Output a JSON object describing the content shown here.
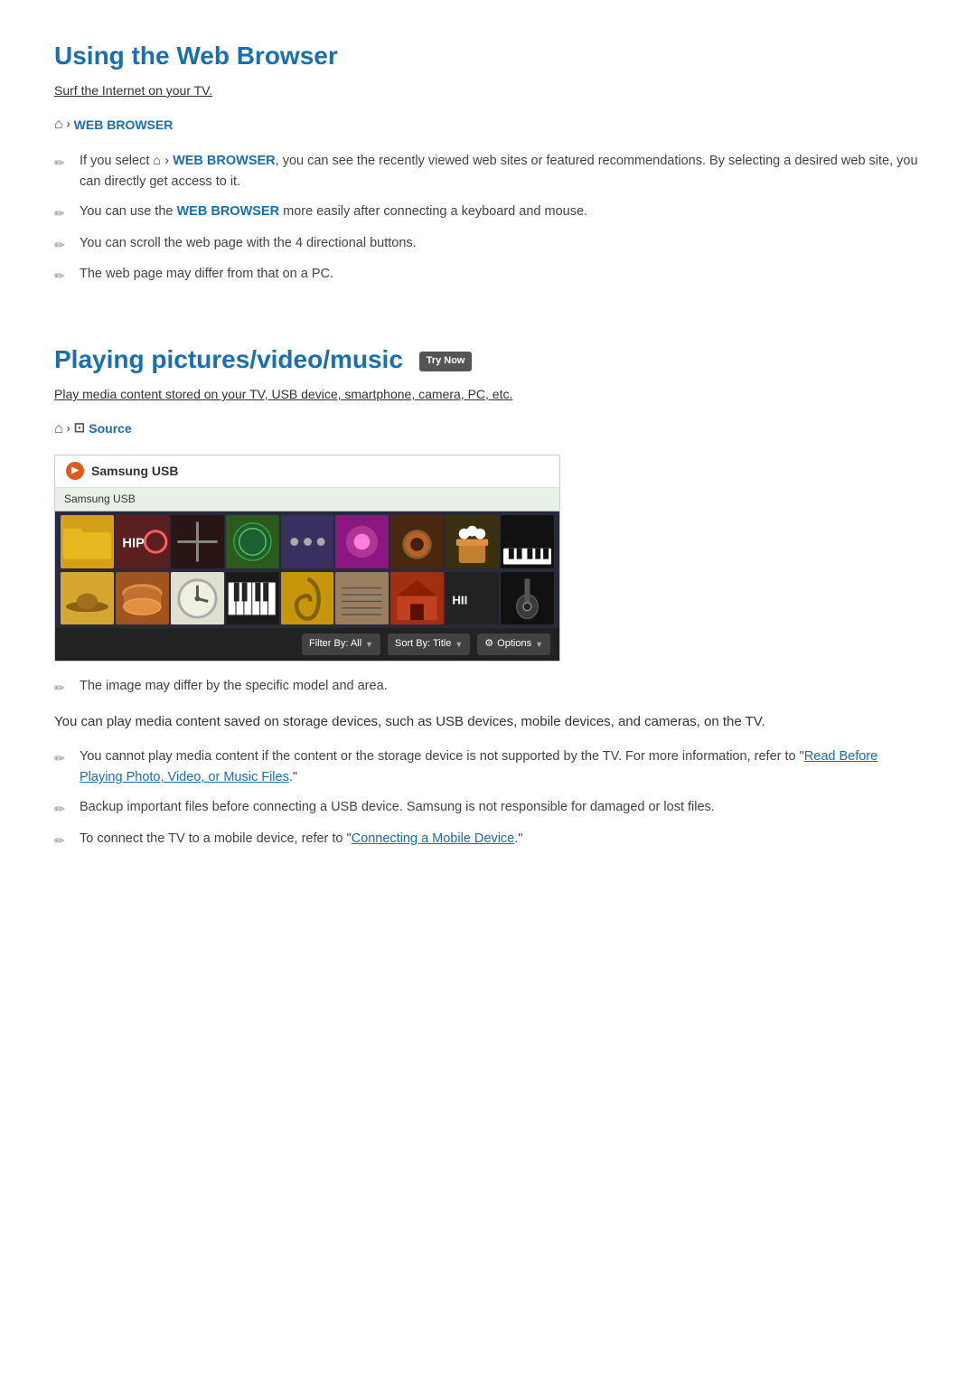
{
  "sections": {
    "web_browser": {
      "title": "Using the Web Browser",
      "subtitle": "Surf the Internet on your TV.",
      "breadcrumb": {
        "home_symbol": "⌂",
        "chevron": "›",
        "label": "WEB BROWSER"
      },
      "bullets": [
        {
          "id": "wb1",
          "text_parts": [
            "If you select ",
            "home",
            " › ",
            "WEB BROWSER",
            ", you can see the recently viewed web sites or featured recommendations. By selecting a desired web site, you can directly get access to it."
          ]
        },
        {
          "id": "wb2",
          "text_parts": [
            "You can use the ",
            "WEB BROWSER",
            " more easily after connecting a keyboard and mouse."
          ]
        },
        {
          "id": "wb3",
          "text_parts": [
            "You can scroll the web page with the 4 directional buttons."
          ]
        },
        {
          "id": "wb4",
          "text_parts": [
            "The web page may differ from that on a PC."
          ]
        }
      ]
    },
    "media": {
      "title": "Playing pictures/video/music",
      "try_now_badge": "Try Now",
      "subtitle": "Play media content stored on your TV, USB device, smartphone, camera, PC, etc.",
      "breadcrumb": {
        "home_symbol": "⌂",
        "chevron": "›",
        "folder_symbol": "⊡",
        "label": "Source"
      },
      "browser": {
        "device_name": "Samsung USB",
        "tab_label": "Samsung USB",
        "footer_buttons": [
          {
            "label": "Filter By: All"
          },
          {
            "label": "Sort By: Title"
          },
          {
            "label": "Options",
            "has_icon": true
          }
        ]
      },
      "image_note_bullet": "The image may differ by the specific model and area.",
      "note_paragraph": "You can play media content saved on storage devices, such as USB devices, mobile devices, and cameras, on the TV.",
      "bullets": [
        {
          "id": "mb1",
          "text_parts": [
            "You cannot play media content if the content or the storage device is not supported by the TV. For more information, refer to \"",
            "Read Before Playing Photo, Video, or Music Files",
            ".\""
          ]
        },
        {
          "id": "mb2",
          "text_parts": [
            "Backup important files before connecting a USB device. Samsung is not responsible for damaged or lost files."
          ]
        },
        {
          "id": "mb3",
          "text_parts": [
            "To connect the TV to a mobile device, refer to \"",
            "Connecting a Mobile Device",
            ".\""
          ]
        }
      ]
    }
  }
}
